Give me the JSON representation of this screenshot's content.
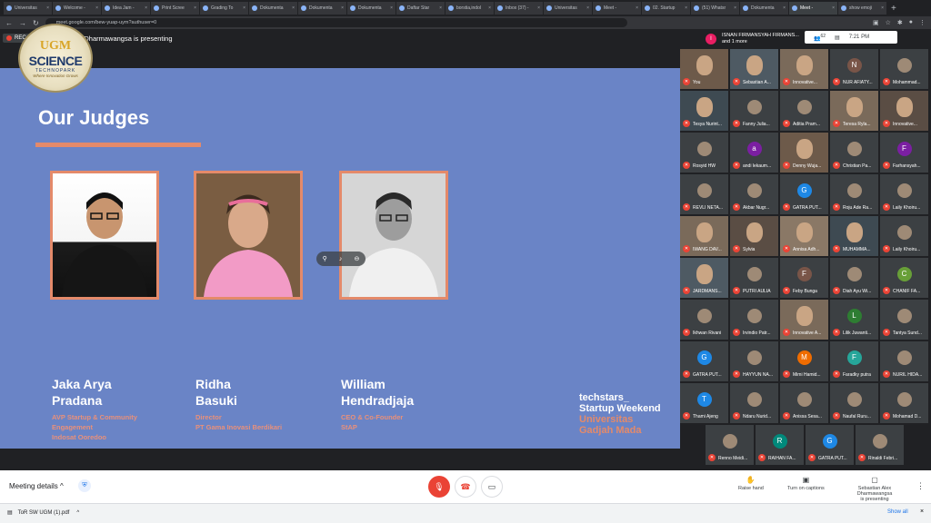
{
  "browser": {
    "tabs": [
      "Universitas",
      "Welcome -",
      "Idea Jam -",
      "Print Scree",
      "Grading To",
      "Dokumenta",
      "Dokumenta",
      "Dokumenta",
      "Daftar Star",
      "borstia,indol",
      "Inbox (37) -",
      "Universitas",
      "Meet -",
      "02. Startup",
      "(51) Whatsr",
      "Dokumenta",
      "Meet -",
      "show emoji"
    ],
    "url": "meet.google.com/bew-yuap-uym?authuser=0"
  },
  "meeting": {
    "rec_label": "REC",
    "presenting_banner": "Sebastian Alex Dharmawangsa is presenting",
    "people_line1": "ISNAN FIRMANSYAH FIRMANS...",
    "people_line2": "and 1 more",
    "people_count": "62",
    "time": "7:21 PM"
  },
  "logo": {
    "ugm": "UGM",
    "science": "SCIENCE",
    "technopark": "TECHNOPARK",
    "tagline": "Where Innovation Grows"
  },
  "slide": {
    "title": "Our Judges",
    "judges": [
      {
        "first": "Jaka Arya",
        "last": "Pradana",
        "role": [
          "AVP Startup & Community",
          "Engagement",
          "Indosat Ooredoo"
        ]
      },
      {
        "first": "Ridha",
        "last": "Basuki",
        "role": [
          "Director",
          "PT Gama Inovasi Berdikari"
        ]
      },
      {
        "first": "William",
        "last": "Hendradjaja",
        "role": [
          "CEO & Co-Founder",
          "StAP"
        ]
      }
    ],
    "brand": [
      "techstars_",
      "Startup Weekend",
      "Universitas",
      "Gadjah Mada"
    ]
  },
  "participants": [
    {
      "name": "You",
      "video": true
    },
    {
      "name": "Sebastian A...",
      "video": true
    },
    {
      "name": "Innovative...",
      "video": true
    },
    {
      "name": "NUR AFIATY...",
      "initial": "N",
      "color": "#795548"
    },
    {
      "name": "Mohammad...",
      "video": false
    },
    {
      "name": "Tesya Nurint...",
      "video": true
    },
    {
      "name": "Fanny Julia...",
      "video": false
    },
    {
      "name": "Aditia Pram...",
      "video": false
    },
    {
      "name": "Teresa Ryla...",
      "video": true
    },
    {
      "name": "Innovative...",
      "video": true
    },
    {
      "name": "Rosyid HW",
      "video": false
    },
    {
      "name": "andi lekaum...",
      "initial": "a",
      "color": "#7b1fa2"
    },
    {
      "name": "Denny Wuja...",
      "video": true
    },
    {
      "name": "Christian Pa...",
      "video": false
    },
    {
      "name": "Farhansyah...",
      "initial": "F",
      "color": "#7b1fa2"
    },
    {
      "name": "REVLI NETA...",
      "video": false
    },
    {
      "name": "Akbar Nugr...",
      "video": false
    },
    {
      "name": "GATRA PUT...",
      "initial": "G",
      "color": "#1e88e5"
    },
    {
      "name": "Roju Ade Ra...",
      "video": false
    },
    {
      "name": "Laily Khoiru...",
      "video": false
    },
    {
      "name": "IWANG DAV...",
      "video": true
    },
    {
      "name": "Sylvia",
      "video": true
    },
    {
      "name": "Annisa Adh...",
      "video": true
    },
    {
      "name": "MUHAMMA...",
      "video": true
    },
    {
      "name": "Laily Khoiru...",
      "video": false
    },
    {
      "name": "JARDMANS...",
      "video": true
    },
    {
      "name": "PUTRI AULIA",
      "video": false
    },
    {
      "name": "Feby Bunga",
      "initial": "F",
      "color": "#795548"
    },
    {
      "name": "Diah Ayu Wi...",
      "video": false
    },
    {
      "name": "CHANIF FA...",
      "initial": "C",
      "color": "#689f38"
    },
    {
      "name": "Ikhwan Rivani",
      "video": false
    },
    {
      "name": "Irvindio Patr...",
      "video": false
    },
    {
      "name": "Innovative A...",
      "video": true
    },
    {
      "name": "Lilik Juwanti...",
      "initial": "L",
      "color": "#2e7d32"
    },
    {
      "name": "Tantya Sund...",
      "video": false
    },
    {
      "name": "GATRA PUT...",
      "initial": "G",
      "color": "#1e88e5"
    },
    {
      "name": "HAYYUN NA...",
      "video": false
    },
    {
      "name": "Mimi Hamid...",
      "initial": "M",
      "color": "#ef6c00"
    },
    {
      "name": "Faradky putra",
      "initial": "F",
      "color": "#26a69a"
    },
    {
      "name": "NURIL HIDA...",
      "video": false
    },
    {
      "name": "Thami Ajeng",
      "initial": "T",
      "color": "#1e88e5"
    },
    {
      "name": "Ndaru Nurid...",
      "video": false
    },
    {
      "name": "Anissa Sesa...",
      "video": false
    },
    {
      "name": "Naufal Ruru...",
      "video": false
    },
    {
      "name": "Mohamad D...",
      "video": false
    },
    {
      "name": "Renno Meidi...",
      "video": false
    },
    {
      "name": "RAIHAN FA...",
      "initial": "R",
      "color": "#00897b"
    },
    {
      "name": "GATRA PUT...",
      "initial": "G",
      "color": "#1e88e5"
    },
    {
      "name": "Rinaldi Febri...",
      "video": false
    }
  ],
  "bottom": {
    "meeting_details": "Meeting details",
    "raise_hand": "Raise hand",
    "captions": "Turn on captions",
    "presenter_line1": "Sebastian Alex Dharmawangsa",
    "presenter_line2": "is presenting"
  },
  "downloads": {
    "file": "ToR SW UGM (1).pdf",
    "show_all": "Show all"
  }
}
